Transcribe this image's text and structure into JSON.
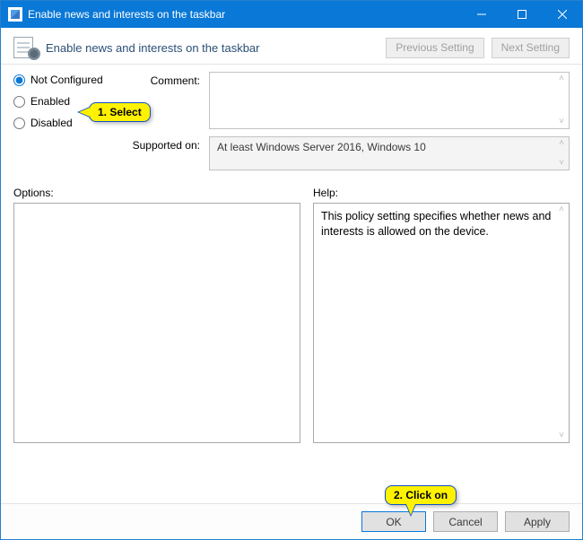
{
  "window": {
    "title": "Enable news and interests on the taskbar"
  },
  "subtitle": "Enable news and interests on the taskbar",
  "nav": {
    "previous": "Previous Setting",
    "next": "Next Setting"
  },
  "radios": {
    "not_configured": "Not Configured",
    "enabled": "Enabled",
    "disabled": "Disabled",
    "selected": "not_configured"
  },
  "labels": {
    "comment": "Comment:",
    "supported_on": "Supported on:",
    "options": "Options:",
    "help": "Help:"
  },
  "supported_on": "At least Windows Server 2016, Windows 10",
  "help_text": "This policy setting specifies whether news and interests is allowed on the device.",
  "buttons": {
    "ok": "OK",
    "cancel": "Cancel",
    "apply": "Apply"
  },
  "callouts": {
    "select": "1. Select",
    "click_on": "2. Click on"
  }
}
